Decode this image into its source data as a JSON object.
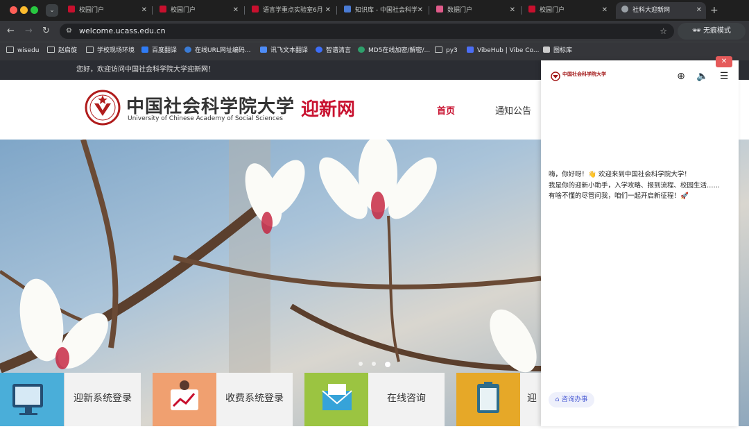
{
  "browser": {
    "tabs": [
      {
        "title": "校园门户",
        "favicon_color": "#c8102e"
      },
      {
        "title": "校园门户",
        "favicon_color": "#c8102e"
      },
      {
        "title": "语言学重点实验室6月",
        "favicon_color": "#c8102e"
      },
      {
        "title": "知识库 - 中国社会科学",
        "favicon_color": "#4a7bd4"
      },
      {
        "title": "数据门户",
        "favicon_color": "#e05b8a"
      },
      {
        "title": "校园门户",
        "favicon_color": "#c8102e"
      },
      {
        "title": "社科大迎新网",
        "favicon_color": "#9aa0a6",
        "active": true
      }
    ],
    "url": "welcome.ucass.edu.cn",
    "incognito_label": "无痕模式",
    "bookmarks": [
      {
        "label": "wisedu",
        "icon": "folder-icon"
      },
      {
        "label": "赵启旋",
        "icon": "folder-icon"
      },
      {
        "label": "学校现场环境",
        "icon": "folder-icon"
      },
      {
        "label": "百度翻译",
        "icon": "translate-icon",
        "color": "#2f7cf6"
      },
      {
        "label": "在线URL网址编码...",
        "icon": "shield-icon",
        "color": "#3a7bd5"
      },
      {
        "label": "讯飞文本翻译",
        "icon": "chat-icon",
        "color": "#4e8cf7"
      },
      {
        "label": "智谱清言",
        "icon": "zhipu-icon",
        "color": "#3d6ef7"
      },
      {
        "label": "MD5在线加密/解密/...",
        "icon": "gear-icon",
        "color": "#2e9f6b"
      },
      {
        "label": "py3",
        "icon": "folder-icon"
      },
      {
        "label": "VibeHub | Vibe Co...",
        "icon": "vibe-icon",
        "color": "#4c6ef5"
      },
      {
        "label": "图标库",
        "icon": "image-icon",
        "color": "#cccccc"
      }
    ]
  },
  "site": {
    "welcome": "您好，欢迎访问中国社会科学院大学迎新网！",
    "logo_cn": "中国社会科学院大学",
    "logo_en": "University of Chinese Academy of Social Sciences",
    "logo_suffix": "迎新网",
    "nav": [
      "首页",
      "通知公告"
    ],
    "carousel": {
      "slides": 3,
      "active": 3
    },
    "tiles": [
      {
        "label": "迎新系统登录",
        "color": "#4aaed9",
        "icon": "monitor-icon"
      },
      {
        "label": "收费系统登录",
        "color": "#f0a070",
        "icon": "chart-icon"
      },
      {
        "label": "在线咨询",
        "color": "#9bc441",
        "icon": "envelope-icon"
      },
      {
        "label": "迎新",
        "color": "#e6a828",
        "icon": "clipboard-icon"
      }
    ]
  },
  "chat": {
    "logo_text": "中国社会科学院大学",
    "close": "✕",
    "greeting": "嗨，你好呀！👋 欢迎来到中国社会科学院大学！",
    "intro": "我是你的迎新小助手，入学攻略、报到流程、校园生活……",
    "prompt": "有啥不懂的尽管问我，咱们一起开启新征程！🚀",
    "consult_label": "咨询办事"
  }
}
